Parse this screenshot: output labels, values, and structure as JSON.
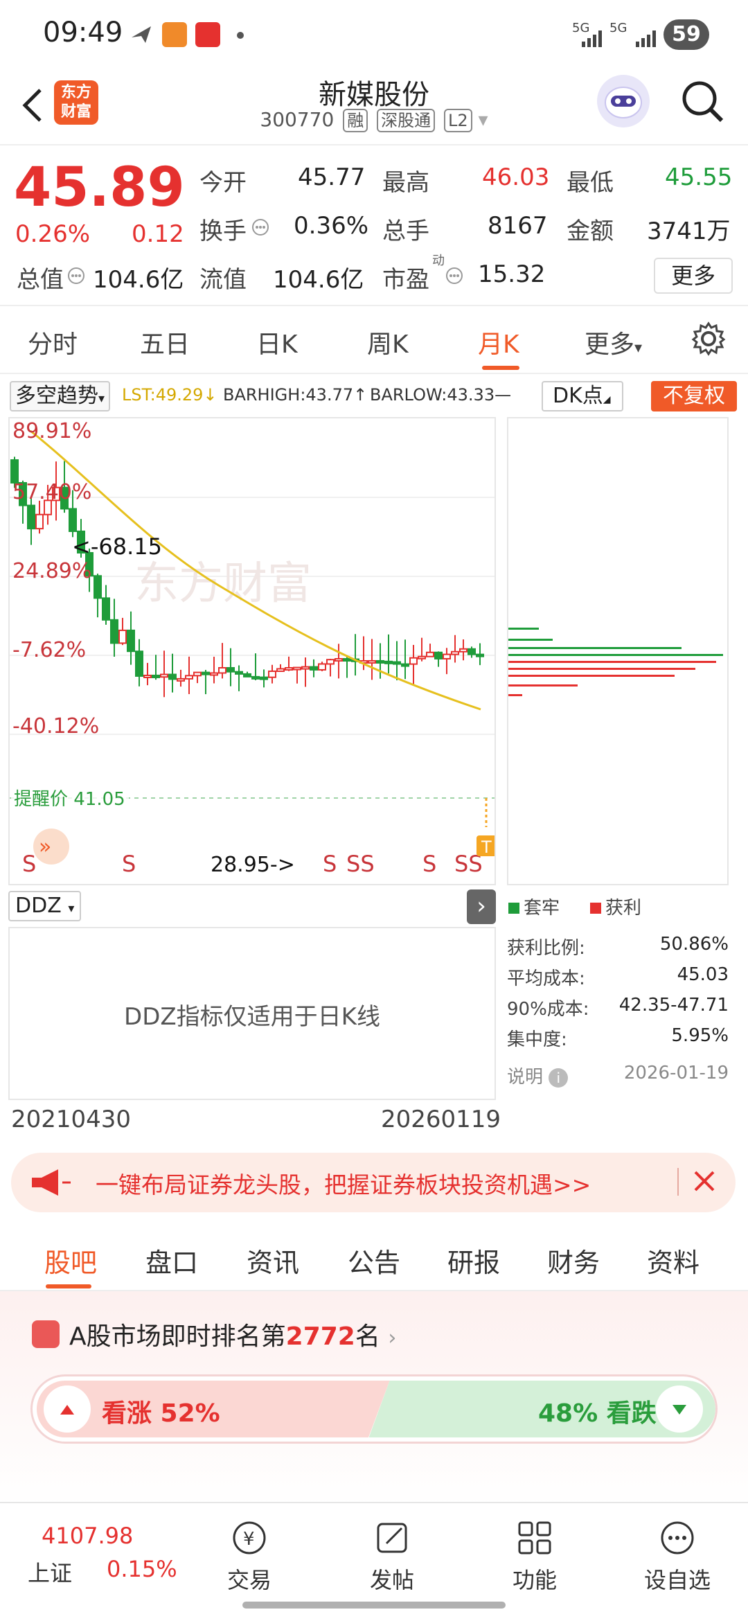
{
  "status_bar": {
    "time": "09:49",
    "network1": "5G",
    "network2": "5G",
    "battery": "59"
  },
  "header": {
    "logo_text": "东方财富",
    "stock_name": "新媒股份",
    "stock_code": "300770",
    "tags": [
      "融",
      "深股通",
      "L2"
    ]
  },
  "quote": {
    "price": "45.89",
    "change_pct": "0.26%",
    "change": "0.12",
    "open_label": "今开",
    "open": "45.77",
    "high_label": "最高",
    "high": "46.03",
    "low_label": "最低",
    "low": "45.55",
    "turnover_label": "换手",
    "turnover": "0.36%",
    "volume_label": "总手",
    "volume": "8167",
    "amount_label": "金额",
    "amount": "3741万",
    "mktcap_label": "总值",
    "mktcap": "104.6亿",
    "float_label": "流值",
    "float_cap": "104.6亿",
    "pe_label": "市盈",
    "pe_sup": "动",
    "pe": "15.32",
    "more_label": "更多"
  },
  "period_tabs": [
    "分时",
    "五日",
    "日K",
    "周K",
    "月K",
    "更多"
  ],
  "active_period": "月K",
  "indicator": {
    "select": "多空趋势",
    "lst": "LST:49.29",
    "barhigh": "BARHIGH:43.77",
    "barlow": "BARLOW:43.33",
    "dk_label": "DK点",
    "fq_label": "不复权"
  },
  "chart_data": {
    "type": "candlestick",
    "y_tick_labels": [
      "89.91%",
      "57.40%",
      "24.89%",
      "-7.62%",
      "-40.12%"
    ],
    "annotations": {
      "high_label": "<-68.15",
      "low_label": "28.95->",
      "alert_label": "提醒价 41.05",
      "signals": [
        "S",
        "S",
        "S",
        "SS",
        "S",
        "SS"
      ]
    },
    "watermark": "东方财富",
    "x_start": "20210430",
    "x_end": "20260119",
    "colors": {
      "up": "#e5312f",
      "down": "#1e9c3a",
      "ma": "#e6c01e"
    }
  },
  "ddz": {
    "select": "DDZ",
    "message": "DDZ指标仅适用于日K线"
  },
  "cost_panel": {
    "legend_trapped": "套牢",
    "legend_profit": "获利",
    "rows": [
      {
        "label": "获利比例:",
        "value": "50.86%"
      },
      {
        "label": "平均成本:",
        "value": "45.03"
      },
      {
        "label": "90%成本:",
        "value": "42.35-47.71"
      },
      {
        "label": "集中度:",
        "value": "5.95%"
      }
    ],
    "note_label": "说明",
    "date": "2026-01-19"
  },
  "banner": {
    "text": "一键布局证券龙头股，把握证券板块投资机遇>>"
  },
  "content_tabs": [
    "股吧",
    "盘口",
    "资讯",
    "公告",
    "研报",
    "财务",
    "资料"
  ],
  "active_content_tab": "股吧",
  "rank": {
    "prefix": "A股市场即时排名第",
    "number": "2772",
    "suffix": "名",
    "up_label": "看涨 52%",
    "up_pct": 52,
    "down_label": "48% 看跌",
    "down_pct": 48
  },
  "bottom_nav": {
    "index_value": "4107.98",
    "index_name": "上证",
    "index_change": "0.15%",
    "items": [
      "交易",
      "发帖",
      "功能",
      "设自选"
    ]
  }
}
